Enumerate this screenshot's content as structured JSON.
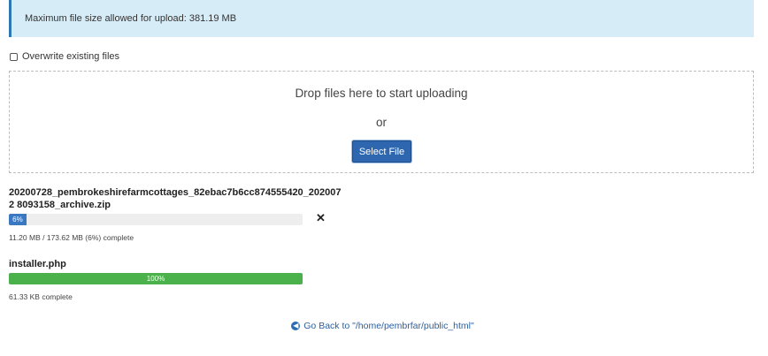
{
  "alert": {
    "text": "Maximum file size allowed for upload: 381.19 MB"
  },
  "overwrite": {
    "label": "Overwrite existing files",
    "checked": false
  },
  "dropzone": {
    "text": "Drop files here to start uploading",
    "or": "or",
    "select_button": "Select File"
  },
  "uploads": [
    {
      "name": "20200728_pembrokeshirefarmcottages_82ebac7b6cc874555420_2020072 8093158_archive.zip",
      "percent": 6,
      "percent_label": "6%",
      "status": "11.20 MB / 173.62 MB (6%) complete",
      "color": "#3a78c2"
    },
    {
      "name": "installer.php",
      "percent": 100,
      "percent_label": "100%",
      "status": "61.33 KB complete",
      "color": "#4bb14b"
    }
  ],
  "icons": {
    "cancel": "close-icon",
    "back": "arrow-left-circle-icon"
  },
  "go_back": {
    "label": "Go Back to \"/home/pembrfar/public_html\""
  }
}
